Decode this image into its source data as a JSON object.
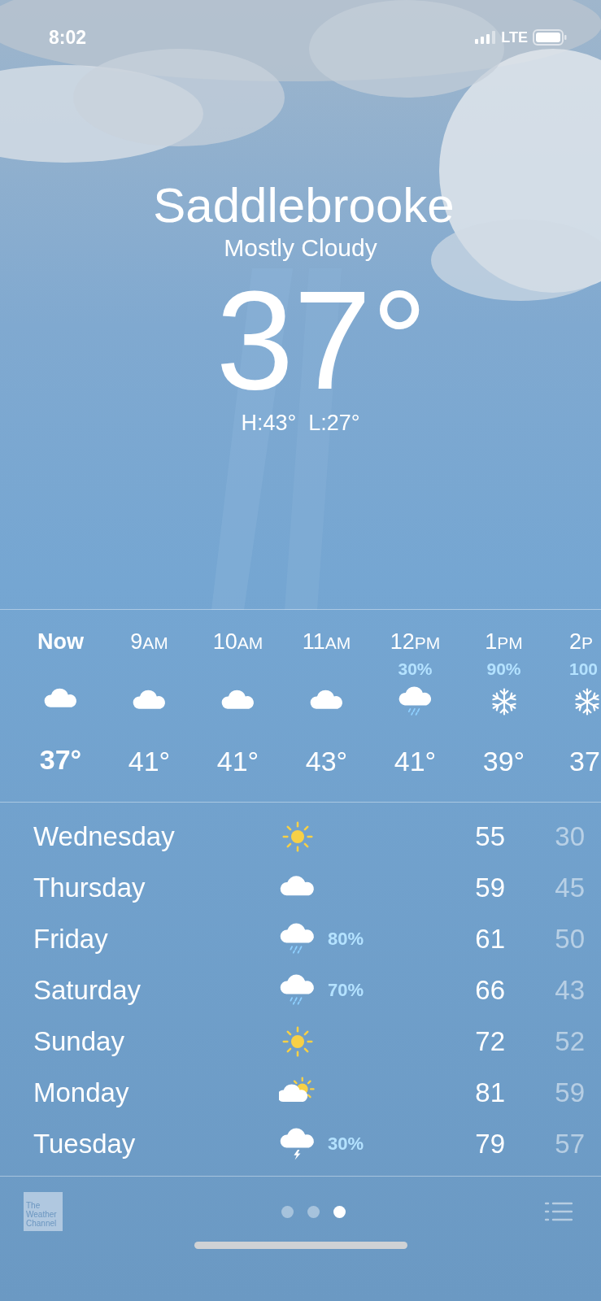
{
  "status_bar": {
    "time": "8:02",
    "network": "LTE"
  },
  "current": {
    "city": "Saddlebrooke",
    "condition": "Mostly Cloudy",
    "temperature": "37°",
    "high_low": "H:43°  L:27°"
  },
  "hourly": [
    {
      "hour": "Now",
      "kind": "cloud",
      "temp": "37°",
      "current": true
    },
    {
      "hour": "9",
      "period": "AM",
      "kind": "cloud",
      "temp": "41°",
      "current": false
    },
    {
      "hour": "10",
      "period": "AM",
      "kind": "cloud",
      "temp": "41°",
      "current": false
    },
    {
      "hour": "11",
      "period": "AM",
      "kind": "cloud",
      "temp": "43°",
      "current": false
    },
    {
      "hour": "12",
      "period": "PM",
      "chance": "30%",
      "kind": "rain",
      "temp": "41°",
      "current": false
    },
    {
      "hour": "1",
      "period": "PM",
      "chance": "90%",
      "kind": "snow",
      "temp": "39°",
      "current": false
    },
    {
      "hour": "2",
      "period": "P",
      "chance": "100",
      "kind": "snow",
      "temp": "37",
      "current": false
    }
  ],
  "daily": [
    {
      "day": "Wednesday",
      "kind": "sun",
      "high": "55",
      "low": "30"
    },
    {
      "day": "Thursday",
      "kind": "cloud",
      "high": "59",
      "low": "45"
    },
    {
      "day": "Friday",
      "kind": "rain",
      "chance": "80%",
      "high": "61",
      "low": "50"
    },
    {
      "day": "Saturday",
      "kind": "rain",
      "chance": "70%",
      "high": "66",
      "low": "43"
    },
    {
      "day": "Sunday",
      "kind": "sun",
      "high": "72",
      "low": "52"
    },
    {
      "day": "Monday",
      "kind": "partly_sunny",
      "high": "81",
      "low": "59"
    },
    {
      "day": "Tuesday",
      "kind": "thunder",
      "chance": "30%",
      "high": "79",
      "low": "57"
    }
  ],
  "footer": {
    "logo": "The Weather Channel",
    "pages": [
      {
        "selected": false
      },
      {
        "selected": false
      },
      {
        "selected": true
      }
    ]
  }
}
